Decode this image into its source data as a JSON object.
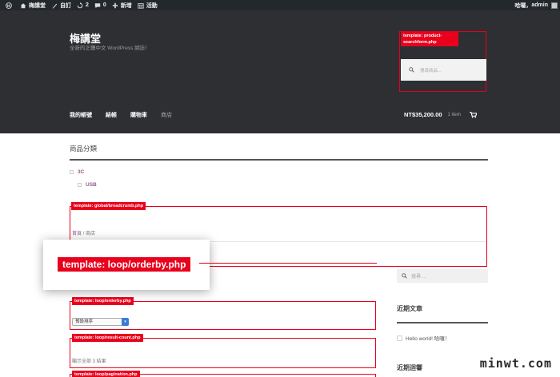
{
  "adminbar": {
    "site_name": "梅講堂",
    "customize": "自訂",
    "updates": "2",
    "comments": "0",
    "new": "新增",
    "activity": "活動",
    "greeting": "哈囉，",
    "user": "admin"
  },
  "header": {
    "site_title": "梅講堂",
    "site_description": "全新的正體中文 WordPress 網誌！",
    "search_tag": "template: product-searchform.php",
    "search_placeholder": "搜尋商品...",
    "nav": [
      "我的帳號",
      "結帳",
      "購物車",
      "商店"
    ],
    "cart_total": "NT$35,200.00",
    "cart_count": "1 item"
  },
  "content": {
    "category_title": "商品分類",
    "categories": [
      "3C",
      "USB"
    ],
    "breadcrumb_tag": "template: global/breadcrumb.php",
    "breadcrumb_home": "首頁",
    "breadcrumb_sep": " / ",
    "breadcrumb_current": "商店",
    "zoom_tag": "template: loop/orderby.php",
    "orderby_tag": "template: loop/orderby.php",
    "orderby_value": "預設排序",
    "result_count_tag": "template: loop/result-count.php",
    "result_count_text": "顯示全部 3 結果",
    "pagination_tag": "template: loop/pagination.php"
  },
  "sidebar": {
    "search_placeholder": "搜尋 ...",
    "recent_posts_title": "近期文章",
    "recent_post_1": "Hello world! 哈囉！",
    "recent_comments_title": "近期迴響"
  },
  "watermark": "minwt.com",
  "colors": {
    "accent": "#e8001c",
    "header_bg": "#2d2f33",
    "link": "#96588a",
    "adminbar": "#23282d"
  }
}
